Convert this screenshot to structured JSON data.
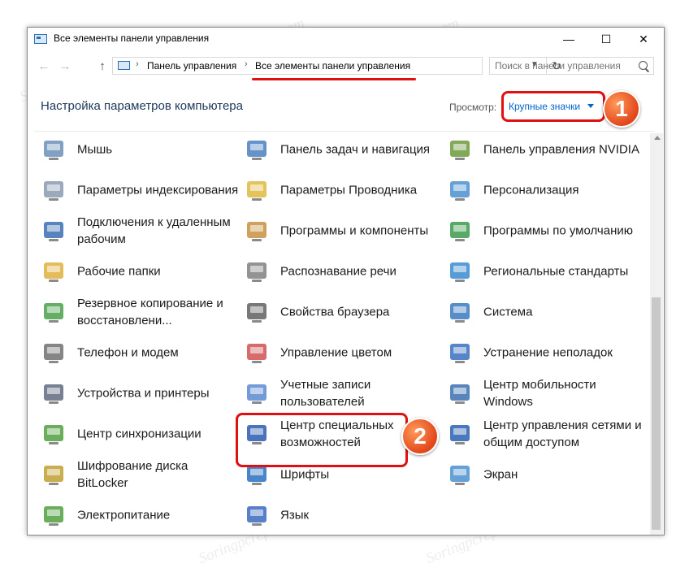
{
  "window": {
    "title": "Все элементы панели управления",
    "controls": {
      "minimize": "—",
      "maximize": "☐",
      "close": "✕"
    }
  },
  "navbar": {
    "back": "←",
    "forward": "→",
    "up": "↑",
    "breadcrumbs": [
      "Панель управления",
      "Все элементы панели управления"
    ],
    "separator": "›",
    "refresh": "↻",
    "search": {
      "placeholder": "Поиск в панели управления"
    }
  },
  "header": {
    "title": "Настройка параметров компьютера",
    "view_label": "Просмотр:",
    "view_value": "Крупные значки"
  },
  "badges": {
    "one": "1",
    "two": "2"
  },
  "items": [
    {
      "label": "Мышь",
      "icon": "mouse-icon"
    },
    {
      "label": "Панель задач и навигация",
      "icon": "taskbar-icon"
    },
    {
      "label": "Панель управления NVIDIA",
      "icon": "nvidia-icon"
    },
    {
      "label": "Параметры индексирования",
      "icon": "indexing-icon"
    },
    {
      "label": "Параметры Проводника",
      "icon": "folder-options-icon"
    },
    {
      "label": "Персонализация",
      "icon": "personalization-icon"
    },
    {
      "label": "Подключения к удаленным рабочим",
      "icon": "remote-desktop-icon"
    },
    {
      "label": "Программы и компоненты",
      "icon": "programs-icon"
    },
    {
      "label": "Программы по умолчанию",
      "icon": "default-programs-icon"
    },
    {
      "label": "Рабочие папки",
      "icon": "work-folders-icon"
    },
    {
      "label": "Распознавание речи",
      "icon": "microphone-icon"
    },
    {
      "label": "Региональные стандарты",
      "icon": "globe-clock-icon"
    },
    {
      "label": "Резервное копирование и восстановлени...",
      "icon": "backup-icon"
    },
    {
      "label": "Свойства браузера",
      "icon": "internet-options-icon"
    },
    {
      "label": "Система",
      "icon": "system-icon"
    },
    {
      "label": "Телефон и модем",
      "icon": "phone-modem-icon"
    },
    {
      "label": "Управление цветом",
      "icon": "color-management-icon"
    },
    {
      "label": "Устранение неполадок",
      "icon": "troubleshooting-icon"
    },
    {
      "label": "Устройства и принтеры",
      "icon": "printer-icon"
    },
    {
      "label": "Учетные записи пользователей",
      "icon": "user-accounts-icon"
    },
    {
      "label": "Центр мобильности Windows",
      "icon": "mobility-center-icon"
    },
    {
      "label": "Центр синхронизации",
      "icon": "sync-center-icon"
    },
    {
      "label": "Центр специальных возможностей",
      "icon": "ease-of-access-icon"
    },
    {
      "label": "Центр управления сетями и общим доступом",
      "icon": "network-center-icon"
    },
    {
      "label": "Шифрование диска BitLocker",
      "icon": "bitlocker-icon"
    },
    {
      "label": "Шрифты",
      "icon": "fonts-icon"
    },
    {
      "label": "Экран",
      "icon": "display-icon"
    },
    {
      "label": "Электропитание",
      "icon": "power-icon"
    },
    {
      "label": "Язык",
      "icon": "language-icon"
    }
  ],
  "watermark": "Soringpcrepair.com",
  "colors": {
    "highlight": "#e01010",
    "link": "#0066cc",
    "title": "#1e395b"
  }
}
